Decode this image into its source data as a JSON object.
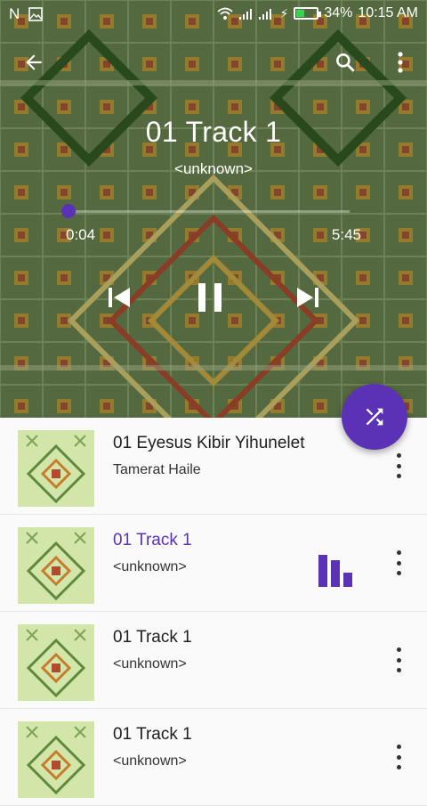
{
  "status_bar": {
    "battery_percent": "34%",
    "time": "10:15 AM",
    "battery_level": 0.34
  },
  "now_playing": {
    "title": "01 Track 1",
    "artist": "<unknown>",
    "elapsed": "0:04",
    "duration": "5:45",
    "progress": 0.012
  },
  "colors": {
    "accent": "#5b31b6"
  },
  "playlist": [
    {
      "title": "01 Eyesus Kibir Yihunelet",
      "artist": "Tamerat Haile",
      "playing": false
    },
    {
      "title": "01 Track 1",
      "artist": "<unknown>",
      "playing": true
    },
    {
      "title": "01 Track 1",
      "artist": "<unknown>",
      "playing": false
    },
    {
      "title": "01 Track 1",
      "artist": "<unknown>",
      "playing": false
    }
  ]
}
